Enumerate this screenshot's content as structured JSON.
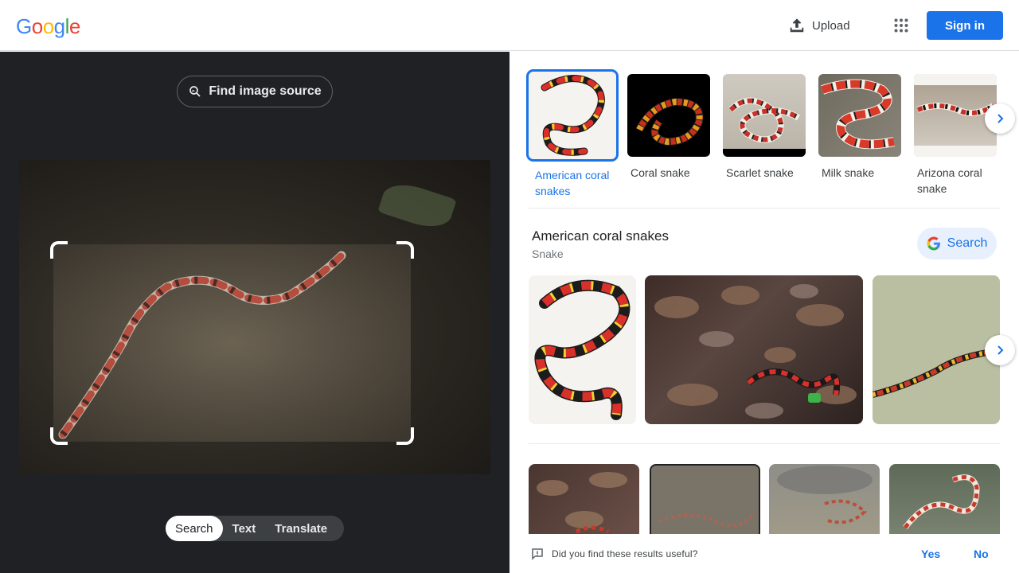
{
  "header": {
    "logo_letters": [
      "G",
      "o",
      "o",
      "g",
      "l",
      "e"
    ],
    "logo_colors": [
      "#4285F4",
      "#EA4335",
      "#FBBC05",
      "#4285F4",
      "#34A853",
      "#EA4335"
    ],
    "upload_label": "Upload",
    "upload_icon": "upload-icon",
    "apps_icon": "apps-grid-icon",
    "signin_label": "Sign in"
  },
  "lens": {
    "find_source_label": "Find image source",
    "find_source_icon": "image-search-icon",
    "modes": [
      {
        "label": "Search",
        "active": true
      },
      {
        "label": "Text",
        "active": false
      },
      {
        "label": "Translate",
        "active": false
      }
    ]
  },
  "related": {
    "items": [
      {
        "label": "American coral snakes",
        "selected": true
      },
      {
        "label": "Coral snake",
        "selected": false
      },
      {
        "label": "Scarlet snake",
        "selected": false
      },
      {
        "label": "Milk snake",
        "selected": false
      },
      {
        "label": "Arizona coral snake",
        "selected": false
      }
    ]
  },
  "knowledge": {
    "title": "American coral snakes",
    "subtitle": "Snake",
    "search_label": "Search"
  },
  "feedback": {
    "question": "Did you find these results useful?",
    "yes": "Yes",
    "no": "No"
  },
  "colors": {
    "accent": "#1a73e8",
    "dark_panel": "#202124"
  }
}
